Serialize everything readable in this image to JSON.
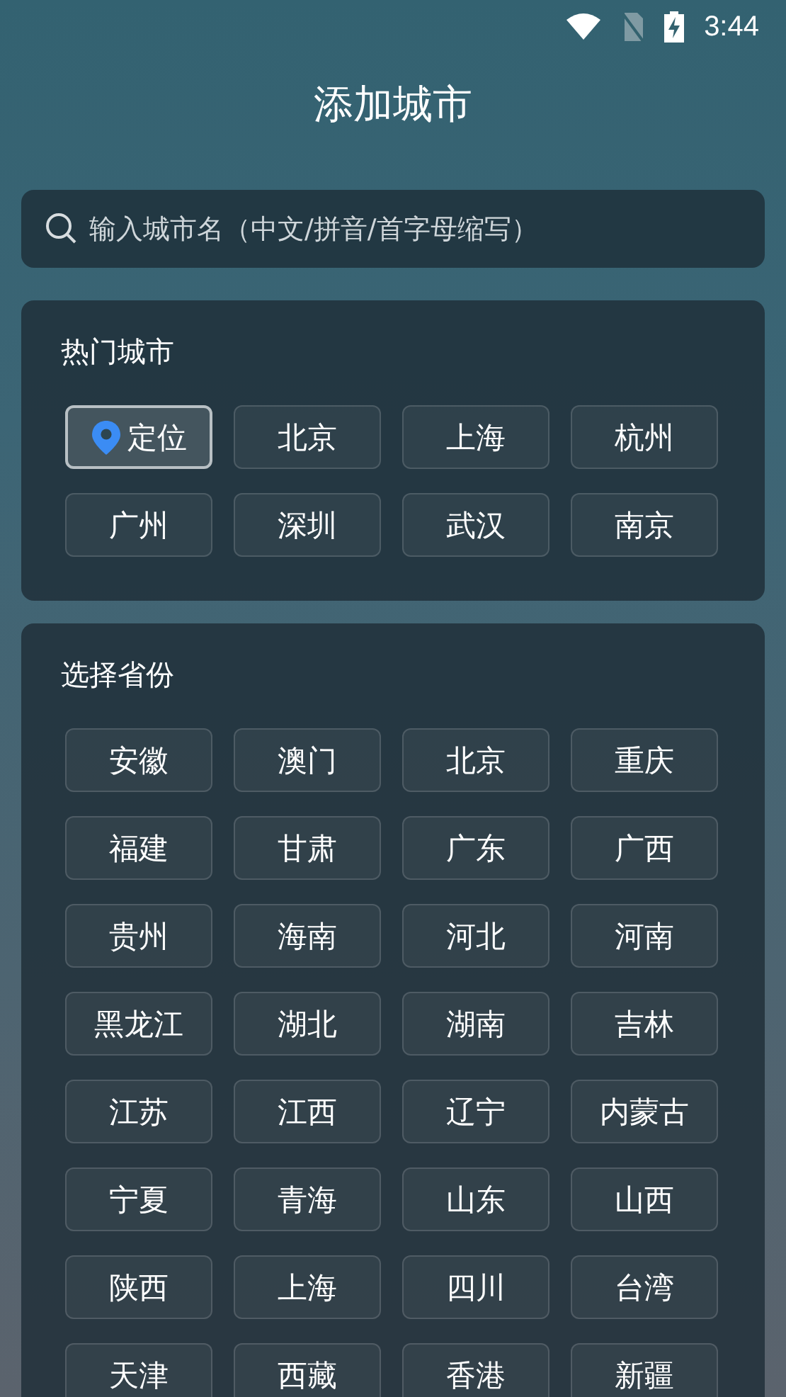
{
  "status_bar": {
    "time": "3:44"
  },
  "title": "添加城市",
  "search": {
    "placeholder": "输入城市名（中文/拼音/首字母缩写）"
  },
  "sections": [
    {
      "title": "热门城市",
      "items": [
        {
          "label": "定位",
          "kind": "locate"
        },
        {
          "label": "北京",
          "kind": "city"
        },
        {
          "label": "上海",
          "kind": "city"
        },
        {
          "label": "杭州",
          "kind": "city"
        },
        {
          "label": "广州",
          "kind": "city"
        },
        {
          "label": "深圳",
          "kind": "city"
        },
        {
          "label": "武汉",
          "kind": "city"
        },
        {
          "label": "南京",
          "kind": "city"
        }
      ]
    },
    {
      "title": "选择省份",
      "items": [
        {
          "label": "安徽",
          "kind": "city"
        },
        {
          "label": "澳门",
          "kind": "city"
        },
        {
          "label": "北京",
          "kind": "city"
        },
        {
          "label": "重庆",
          "kind": "city"
        },
        {
          "label": "福建",
          "kind": "city"
        },
        {
          "label": "甘肃",
          "kind": "city"
        },
        {
          "label": "广东",
          "kind": "city"
        },
        {
          "label": "广西",
          "kind": "city"
        },
        {
          "label": "贵州",
          "kind": "city"
        },
        {
          "label": "海南",
          "kind": "city"
        },
        {
          "label": "河北",
          "kind": "city"
        },
        {
          "label": "河南",
          "kind": "city"
        },
        {
          "label": "黑龙江",
          "kind": "city"
        },
        {
          "label": "湖北",
          "kind": "city"
        },
        {
          "label": "湖南",
          "kind": "city"
        },
        {
          "label": "吉林",
          "kind": "city"
        },
        {
          "label": "江苏",
          "kind": "city"
        },
        {
          "label": "江西",
          "kind": "city"
        },
        {
          "label": "辽宁",
          "kind": "city"
        },
        {
          "label": "内蒙古",
          "kind": "city"
        },
        {
          "label": "宁夏",
          "kind": "city"
        },
        {
          "label": "青海",
          "kind": "city"
        },
        {
          "label": "山东",
          "kind": "city"
        },
        {
          "label": "山西",
          "kind": "city"
        },
        {
          "label": "陕西",
          "kind": "city"
        },
        {
          "label": "上海",
          "kind": "city"
        },
        {
          "label": "四川",
          "kind": "city"
        },
        {
          "label": "台湾",
          "kind": "city"
        },
        {
          "label": "天津",
          "kind": "city"
        },
        {
          "label": "西藏",
          "kind": "city"
        },
        {
          "label": "香港",
          "kind": "city"
        },
        {
          "label": "新疆",
          "kind": "city"
        }
      ]
    }
  ]
}
